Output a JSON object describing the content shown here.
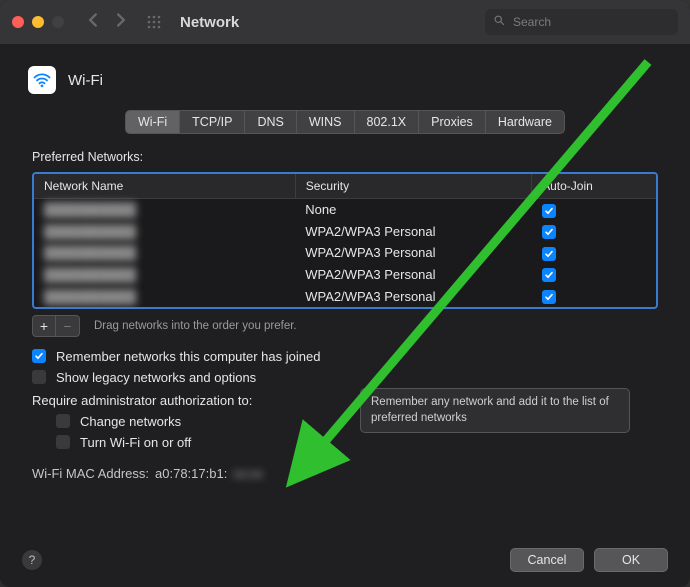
{
  "window": {
    "title": "Network",
    "search_placeholder": "Search"
  },
  "heading": "Wi-Fi",
  "tabs": [
    "Wi-Fi",
    "TCP/IP",
    "DNS",
    "WINS",
    "802.1X",
    "Proxies",
    "Hardware"
  ],
  "tabs_selected": 0,
  "preferred_label": "Preferred Networks:",
  "columns": {
    "name": "Network Name",
    "security": "Security",
    "autojoin": "Auto-Join"
  },
  "networks": [
    {
      "name": "██████████",
      "security": "None",
      "autojoin": true
    },
    {
      "name": "██████████",
      "security": "WPA2/WPA3 Personal",
      "autojoin": true
    },
    {
      "name": "██████████",
      "security": "WPA2/WPA3 Personal",
      "autojoin": true
    },
    {
      "name": "██████████",
      "security": "WPA2/WPA3 Personal",
      "autojoin": true
    },
    {
      "name": "██████████",
      "security": "WPA2/WPA3 Personal",
      "autojoin": true
    }
  ],
  "drag_hint": "Drag networks into the order you prefer.",
  "remember_label": "Remember networks this computer has joined",
  "remember_checked": true,
  "legacy_label": "Show legacy networks and options",
  "legacy_checked": false,
  "require_admin_label": "Require administrator authorization to:",
  "admin_change_label": "Change networks",
  "admin_change_checked": false,
  "admin_toggle_label": "Turn Wi-Fi on or off",
  "admin_toggle_checked": false,
  "tooltip_text": "Remember any network and add it to the list of preferred networks",
  "mac_label": "Wi-Fi MAC Address:",
  "mac_value_visible": "a0:78:17:b1:",
  "buttons": {
    "cancel": "Cancel",
    "ok": "OK"
  },
  "glyphs": {
    "plus": "+",
    "minus": "−",
    "help": "?"
  }
}
